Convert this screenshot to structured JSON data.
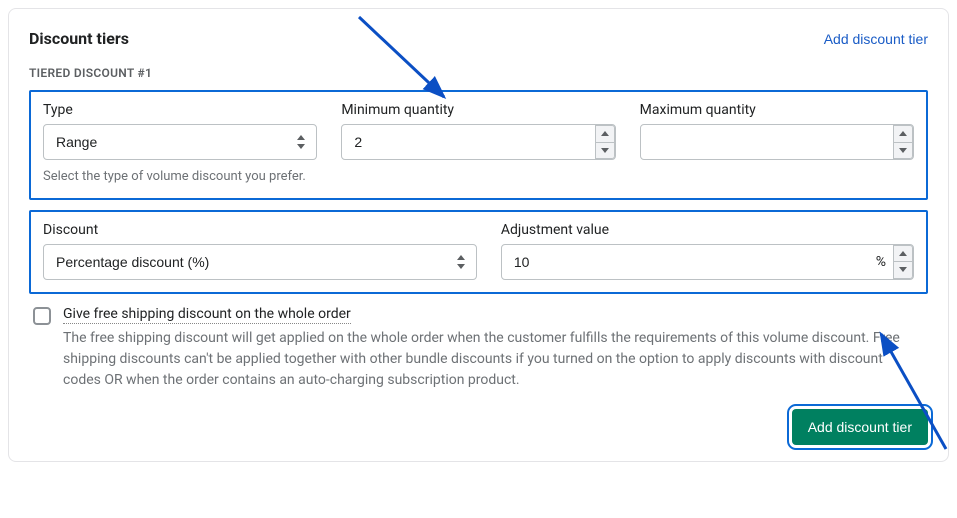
{
  "header": {
    "title": "Discount tiers",
    "add_link": "Add discount tier"
  },
  "tier": {
    "subheader": "TIERED DISCOUNT #1",
    "type": {
      "label": "Type",
      "value": "Range",
      "help": "Select the type of volume discount you prefer."
    },
    "min_qty": {
      "label": "Minimum quantity",
      "value": "2"
    },
    "max_qty": {
      "label": "Maximum quantity",
      "value": ""
    },
    "discount": {
      "label": "Discount",
      "value": "Percentage discount (%)"
    },
    "adjustment": {
      "label": "Adjustment value",
      "value": "10",
      "suffix": "%"
    },
    "free_shipping": {
      "label": "Give free shipping discount on the whole order",
      "desc": "The free shipping discount will get applied on the whole order when the customer fulfills the requirements of this volume discount. Free shipping discounts can't be applied together with other bundle discounts if you turned on the option to apply discounts with discount codes OR when the order contains an auto-charging subscription product."
    }
  },
  "footer": {
    "add_button": "Add discount tier"
  }
}
